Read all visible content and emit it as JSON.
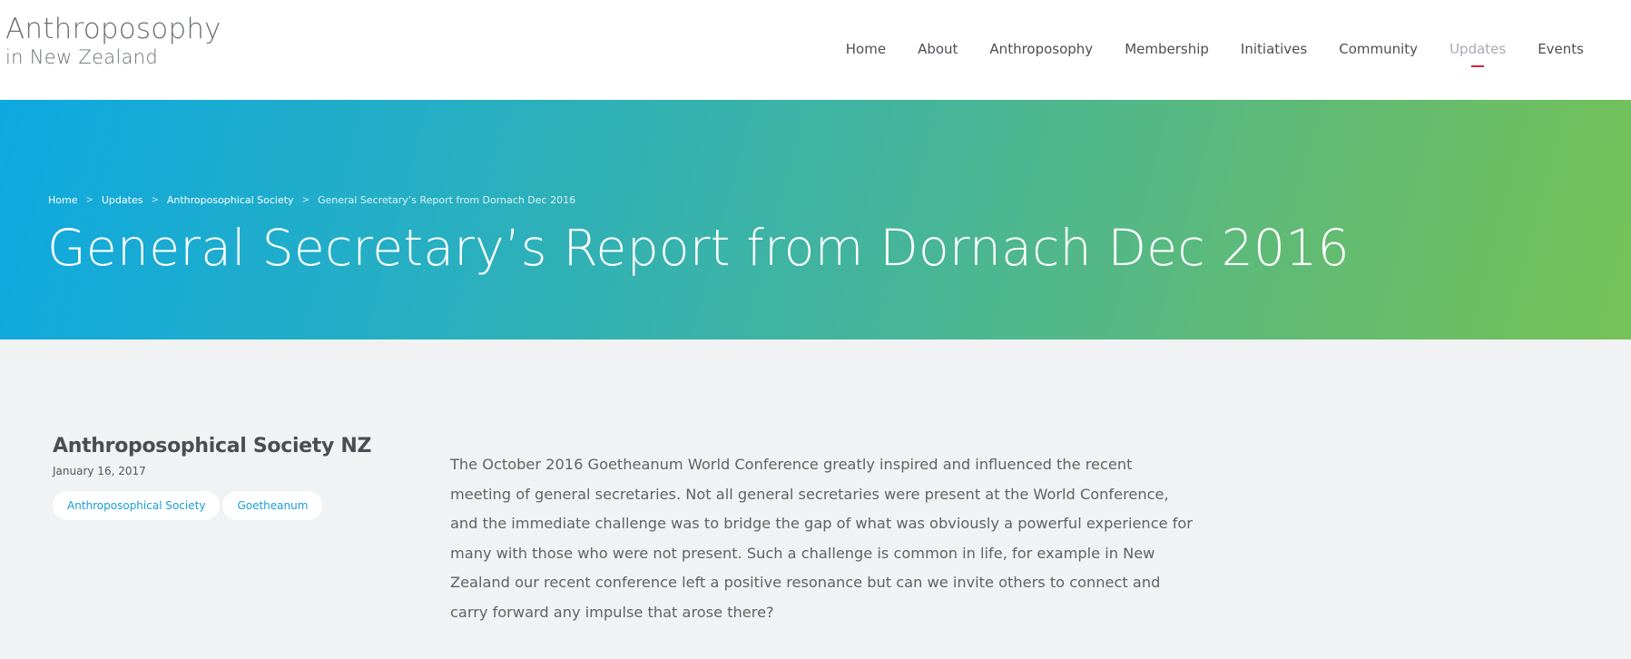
{
  "logo": {
    "line1": "Anthroposophy",
    "line2": "in New Zealand"
  },
  "nav": {
    "items": [
      {
        "label": "Home"
      },
      {
        "label": "About"
      },
      {
        "label": "Anthroposophy"
      },
      {
        "label": "Membership"
      },
      {
        "label": "Initiatives"
      },
      {
        "label": "Community"
      },
      {
        "label": "Updates",
        "active": true
      },
      {
        "label": "Events"
      }
    ]
  },
  "breadcrumb": {
    "items": [
      "Home",
      "Updates",
      "Anthroposophical Society"
    ],
    "current": "General Secretary’s Report from Dornach Dec 2016",
    "separator": ">"
  },
  "page": {
    "title": "General Secretary’s Report from Dornach Dec 2016"
  },
  "post": {
    "author": "Anthroposophical Society NZ",
    "date": "January 16, 2017",
    "tags": [
      "Anthroposophical Society",
      "Goetheanum"
    ],
    "body": "The October 2016 Goetheanum World Conference greatly inspired and influenced the recent meeting of general secretaries. Not all general secretaries were present at the World Conference, and the immediate challenge was to bridge the gap of what was obviously a powerful experience for many with those who were not present. Such a challenge is common in life, for example in New Zealand our recent conference left a positive resonance but can we invite others to connect and carry forward any impulse that arose there?"
  },
  "colors": {
    "accent": "#d6243a",
    "tag_text": "#1a9fd6",
    "hero_start": "#0ea8e0",
    "hero_end": "#76c257"
  }
}
